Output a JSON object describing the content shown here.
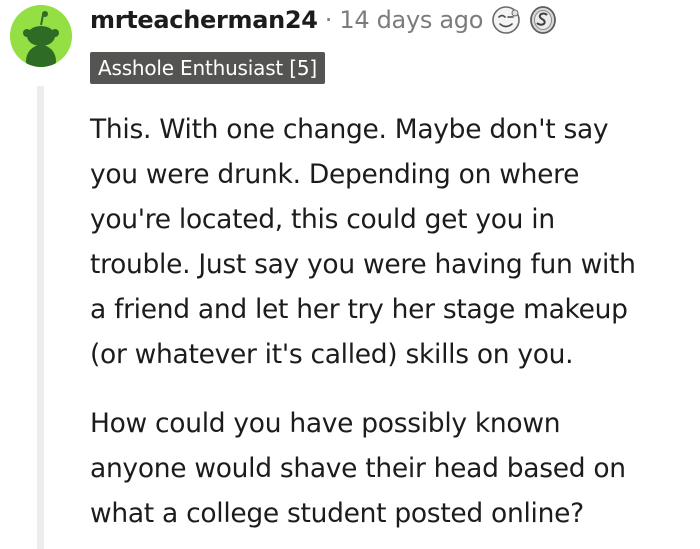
{
  "comment": {
    "username": "mrteacherman24",
    "separator": "·",
    "timestamp": "14 days ago",
    "flair": "Asshole Enthusiast [5]",
    "awards": [
      "wink-award-icon",
      "silver-award-icon"
    ],
    "paragraphs": [
      {
        "lines": [
          "This. With one change. Maybe don't say",
          "you were drunk. Depending on where",
          "you're located, this could get you in",
          "trouble. Just say you were having fun with",
          "a friend and let her try her stage makeup",
          "(or whatever it's called) skills on you."
        ]
      },
      {
        "lines": [
          "How could you have possibly known",
          "anyone would shave their head based on",
          "what a college student posted online?"
        ]
      }
    ]
  },
  "colors": {
    "avatar_bg": "#94e044",
    "flair_bg": "#545452",
    "meta_text": "#7c7c7c",
    "thread_line": "#ededed"
  }
}
